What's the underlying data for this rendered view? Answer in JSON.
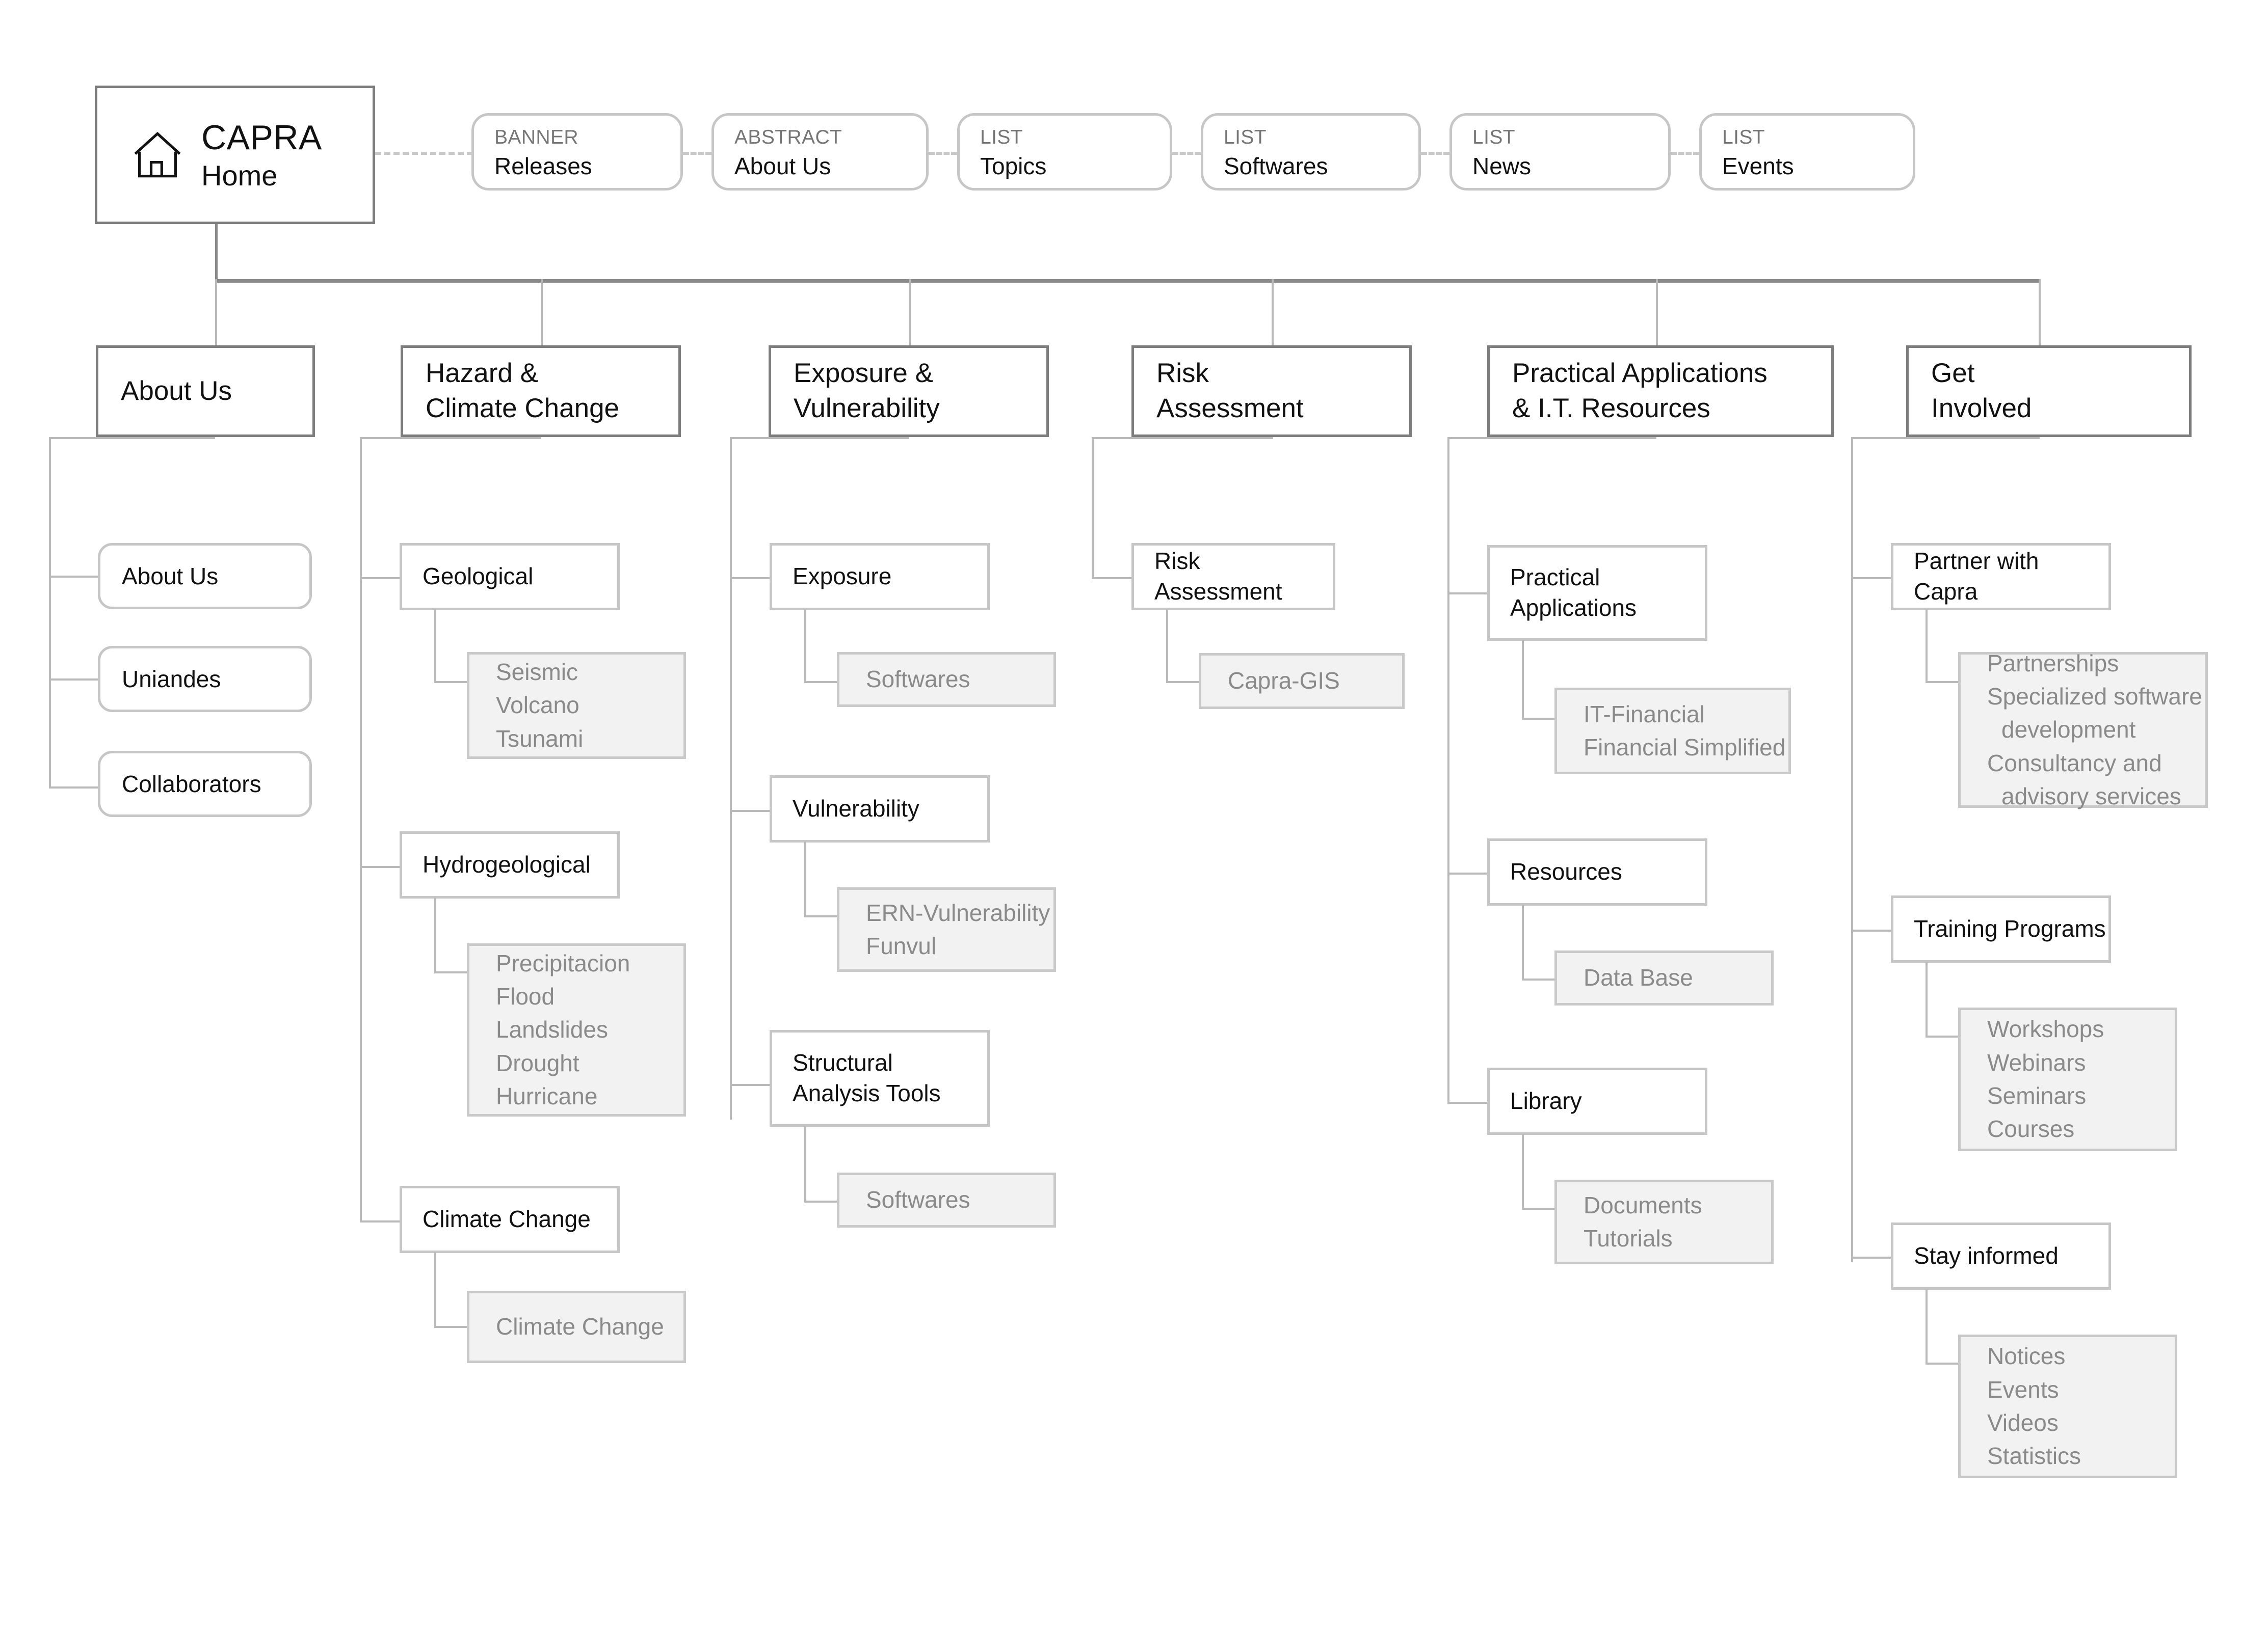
{
  "root": {
    "icon": "home-icon",
    "title": "CAPRA",
    "subtitle": "Home"
  },
  "top_nodes": [
    {
      "kicker": "BANNER",
      "label": "Releases"
    },
    {
      "kicker": "ABSTRACT",
      "label": "About Us"
    },
    {
      "kicker": "LIST",
      "label": "Topics"
    },
    {
      "kicker": "LIST",
      "label": "Softwares"
    },
    {
      "kicker": "LIST",
      "label": "News"
    },
    {
      "kicker": "LIST",
      "label": "Events"
    }
  ],
  "categories": [
    {
      "label": "About Us"
    },
    {
      "label_line1": "Hazard &",
      "label_line2": "Climate Change"
    },
    {
      "label_line1": "Exposure &",
      "label_line2": "Vulnerability"
    },
    {
      "label_line1": "Risk",
      "label_line2": "Assessment"
    },
    {
      "label_line1": "Practical Applications",
      "label_line2": "& I.T. Resources"
    },
    {
      "label_line1": "Get",
      "label_line2": "Involved"
    }
  ],
  "about_us": {
    "children": [
      {
        "label": "About Us"
      },
      {
        "label": "Uniandes"
      },
      {
        "label": "Collaborators"
      }
    ]
  },
  "hazard": {
    "geological": {
      "label": "Geological",
      "leaves": [
        "Seismic",
        "Volcano",
        "Tsunami"
      ]
    },
    "hydrogeological": {
      "label": "Hydrogeological",
      "leaves": [
        "Precipitacion",
        "Flood",
        "Landslides",
        "Drought",
        "Hurricane"
      ]
    },
    "climate_change": {
      "label": "Climate Change",
      "leaves": [
        "Climate Change"
      ]
    }
  },
  "exposure": {
    "exposure": {
      "label": "Exposure",
      "leaves": [
        "Softwares"
      ]
    },
    "vulnerability": {
      "label": "Vulnerability",
      "leaves": [
        "ERN-Vulnerability",
        "Funvul"
      ]
    },
    "structural": {
      "label_line1": "Structural",
      "label_line2": "Analysis Tools",
      "leaves": [
        "Softwares"
      ]
    }
  },
  "risk": {
    "assessment": {
      "label": "Risk Assessment",
      "leaves": [
        "Capra-GIS"
      ]
    }
  },
  "practical": {
    "applications": {
      "label_line1": "Practical",
      "label_line2": "Applications",
      "leaves": [
        "IT-Financial",
        "Financial Simplified"
      ]
    },
    "resources": {
      "label": "Resources",
      "leaves": [
        "Data Base"
      ]
    },
    "library": {
      "label": "Library",
      "leaves": [
        "Documents",
        "Tutorials"
      ]
    }
  },
  "get_involved": {
    "partner": {
      "label": "Partner with Capra",
      "leaves": [
        "Partnerships",
        "Specialized software",
        "development",
        "Consultancy and",
        "advisory services"
      ],
      "wrapped": [
        false,
        false,
        true,
        false,
        true
      ]
    },
    "training": {
      "label": "Training Programs",
      "leaves": [
        "Workshops",
        "Webinars",
        "Seminars",
        "Courses"
      ]
    },
    "stay": {
      "label": "Stay informed",
      "leaves": [
        "Notices",
        "Events",
        "Videos",
        "Statistics"
      ]
    }
  },
  "colors": {
    "strong_border": "#7d7d7d",
    "light_border": "#c6c6c6",
    "leaf_fill": "#f2f2f2",
    "leaf_text": "#8a8a8a",
    "connector": "#b9b9b9",
    "kicker_text": "#757575"
  }
}
